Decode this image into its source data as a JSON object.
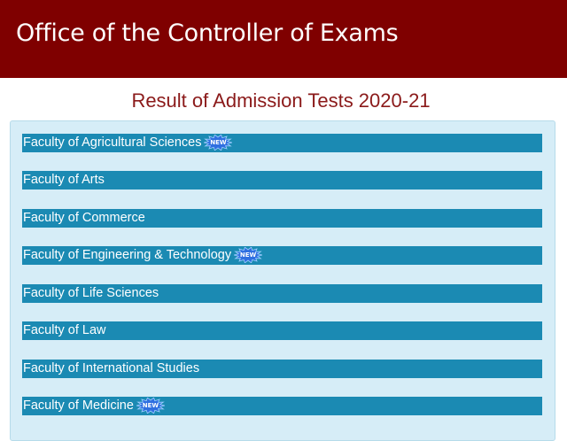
{
  "header": {
    "title": "Office of the Controller of Exams"
  },
  "page": {
    "title": "Result of Admission Tests 2020-21"
  },
  "faculties": [
    {
      "label": "Faculty of Agricultural Sciences",
      "new": true
    },
    {
      "label": "Faculty of Arts",
      "new": false
    },
    {
      "label": "Faculty of Commerce",
      "new": false
    },
    {
      "label": "Faculty of Engineering & Technology",
      "new": true
    },
    {
      "label": "Faculty of Life Sciences",
      "new": false
    },
    {
      "label": "Faculty of Law",
      "new": false
    },
    {
      "label": "Faculty of International Studies",
      "new": false
    },
    {
      "label": "Faculty of Medicine",
      "new": true
    }
  ],
  "badge": {
    "text": "NEW",
    "icon": "new-starburst-icon"
  },
  "colors": {
    "header_bg": "#7f0000",
    "title_text": "#8b1a1a",
    "panel_bg": "#d6edf7",
    "item_bg": "#1b8ab3",
    "badge_fill": "#2f6fe0"
  }
}
